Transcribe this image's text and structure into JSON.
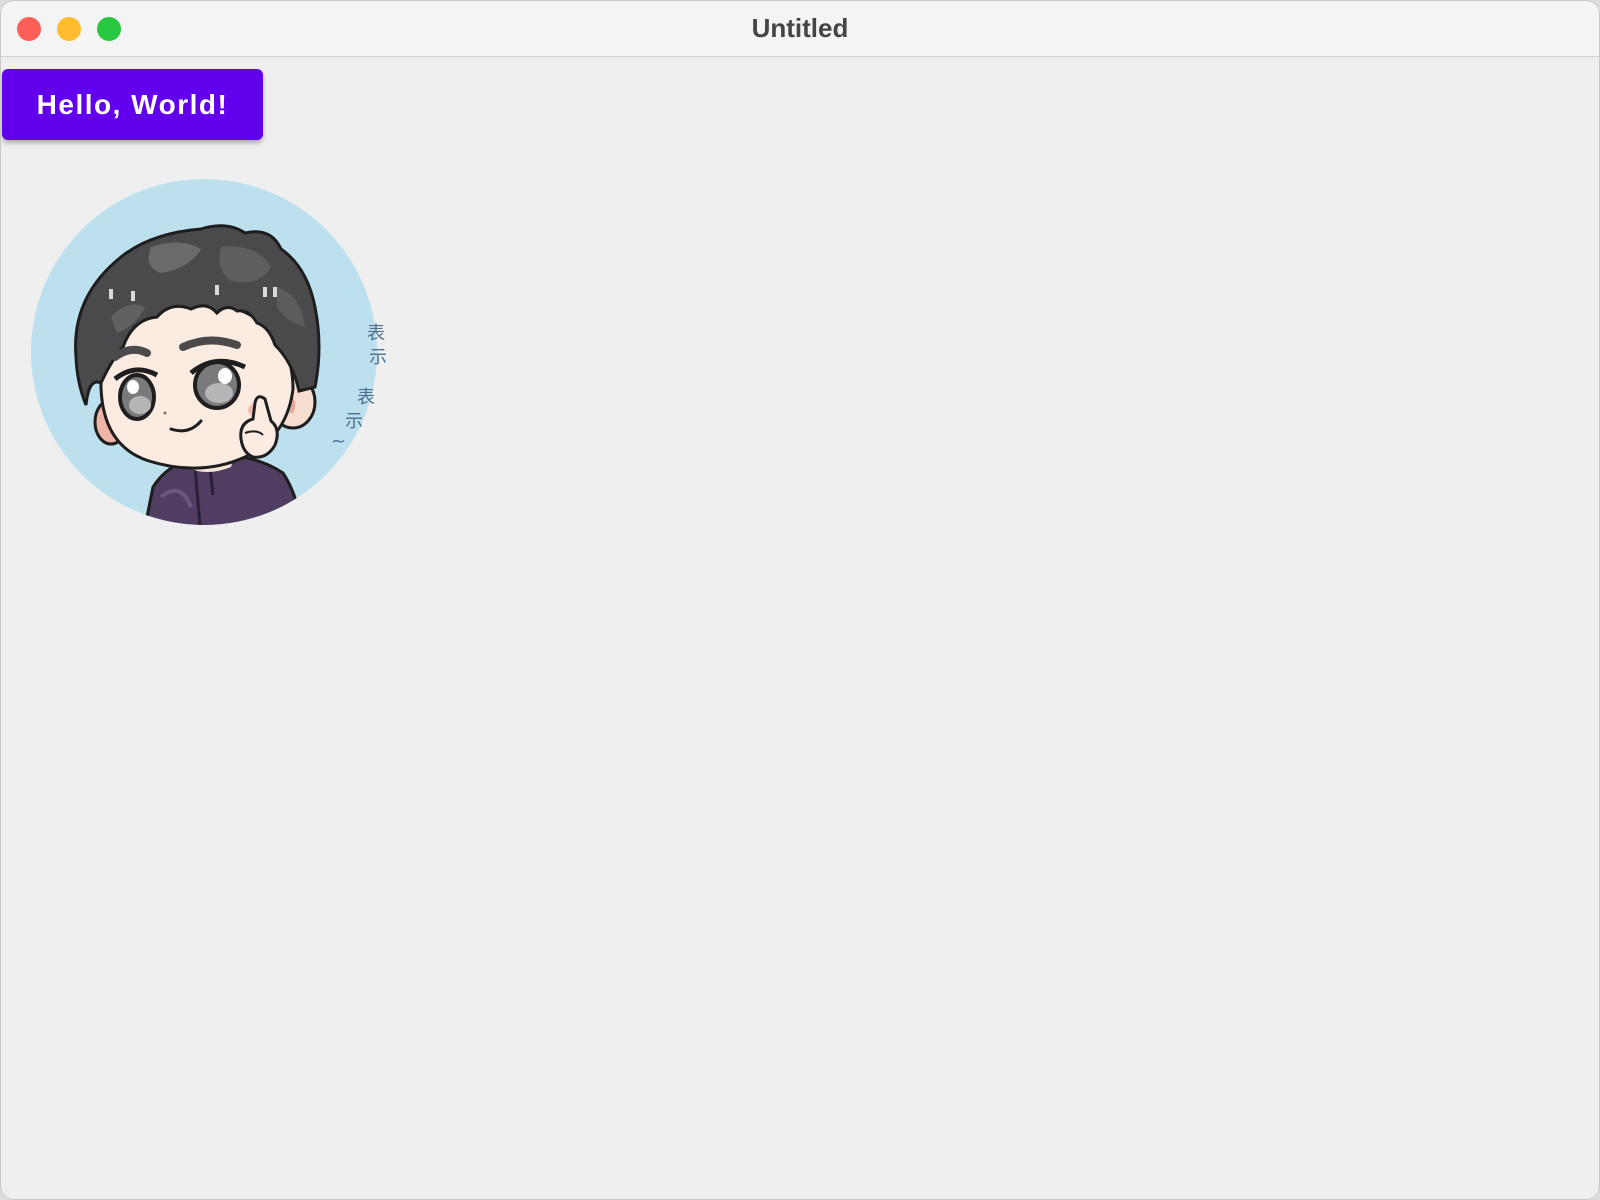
{
  "window": {
    "title": "Untitled",
    "controls": {
      "close_color": "#fe5f57",
      "minimize_color": "#febc2e",
      "zoom_color": "#28c840"
    }
  },
  "main": {
    "hello_button": {
      "label": "Hello, World!",
      "color": "#6200ee",
      "text_color": "#ffffff"
    },
    "avatar": {
      "icon": "cartoon-boy-avatar",
      "background_color": "#bde0ef",
      "caption": "表示表示~"
    }
  }
}
